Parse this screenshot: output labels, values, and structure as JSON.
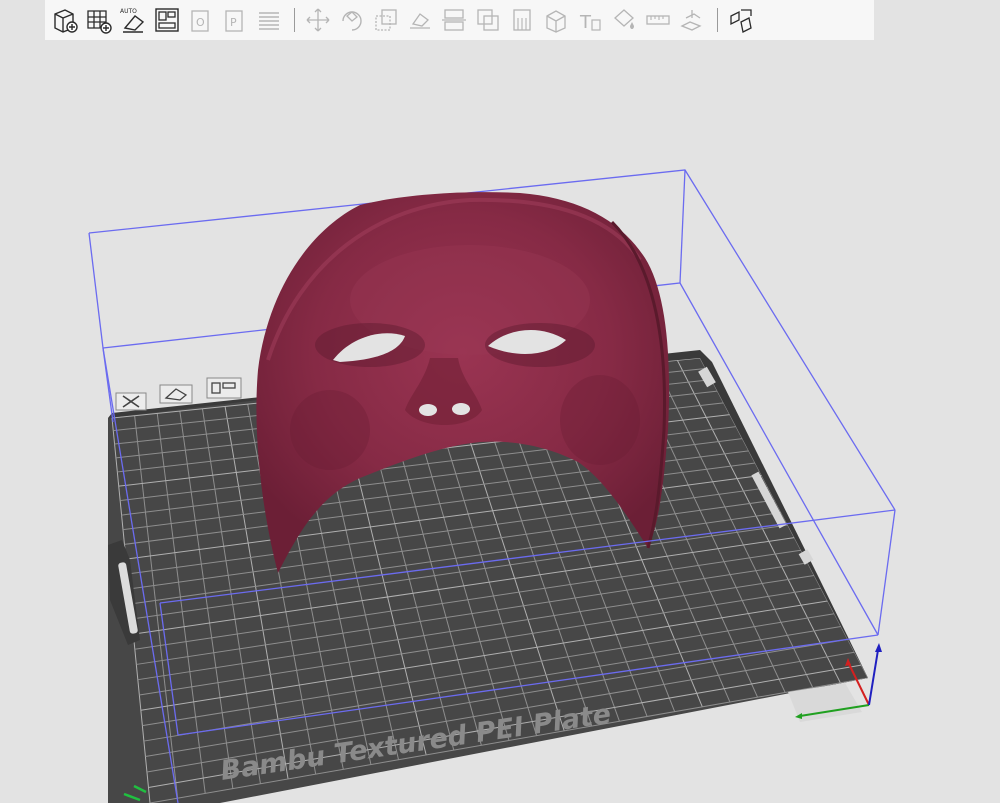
{
  "toolbar": {
    "groups": [
      [
        {
          "name": "add-object-icon",
          "label": "Add",
          "enabled": true
        },
        {
          "name": "add-plate-icon",
          "label": "Add plate",
          "enabled": true
        },
        {
          "name": "auto-orient-icon",
          "label": "AUTO",
          "enabled": true
        },
        {
          "name": "arrange-icon",
          "label": "Arrange",
          "enabled": true
        },
        {
          "name": "split-objects-icon",
          "label": "Split to objects",
          "enabled": false
        },
        {
          "name": "split-parts-icon",
          "label": "Split to parts",
          "enabled": false
        },
        {
          "name": "layers-icon",
          "label": "Variable layer height",
          "enabled": false
        }
      ],
      [
        {
          "name": "move-icon",
          "label": "Move",
          "enabled": false
        },
        {
          "name": "rotate-icon",
          "label": "Rotate",
          "enabled": false
        },
        {
          "name": "scale-icon",
          "label": "Scale",
          "enabled": false
        },
        {
          "name": "lay-on-face-icon",
          "label": "Lay on face",
          "enabled": false
        },
        {
          "name": "cut-icon",
          "label": "Cut",
          "enabled": false
        },
        {
          "name": "mesh-boolean-icon",
          "label": "Mesh boolean",
          "enabled": false
        },
        {
          "name": "support-paint-icon",
          "label": "Support painting",
          "enabled": false
        },
        {
          "name": "seam-paint-icon",
          "label": "Seam painting",
          "enabled": false
        },
        {
          "name": "text-shape-icon",
          "label": "Text shape",
          "enabled": false
        },
        {
          "name": "color-paint-icon",
          "label": "Color painting",
          "enabled": false
        },
        {
          "name": "measure-icon",
          "label": "Measure",
          "enabled": false
        },
        {
          "name": "assembly-icon",
          "label": "Assembly",
          "enabled": false
        }
      ],
      [
        {
          "name": "explode-icon",
          "label": "Assembly view",
          "enabled": true
        }
      ]
    ]
  },
  "plate": {
    "label": "Bambu Textured PEI Plate",
    "icons": [
      "delete-plate-icon",
      "auto-orient-plate-icon",
      "arrange-plate-icon"
    ]
  },
  "colors": {
    "background": "#e3e3e3",
    "plate": "#474747",
    "grid": "#9a9a9a",
    "bounding_box": "#6b6bf0",
    "model": "#8a2a44",
    "axis_x": "#d42020",
    "axis_y": "#20a020",
    "axis_z": "#2020c0"
  }
}
